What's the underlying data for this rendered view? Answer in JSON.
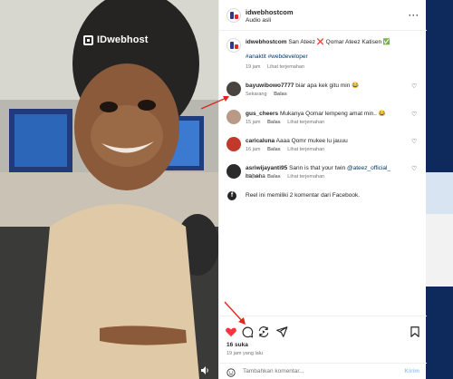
{
  "media": {
    "brand_text": "IDwebhost",
    "brand_icon": "idwebhost-logo-icon"
  },
  "header": {
    "username": "idwebhostcom",
    "subtitle": "Audio asli"
  },
  "caption": {
    "username": "idwebhostcom",
    "text": "San Ateez ❌ Qomar Ateez Katisen ✅",
    "hashtags": "#anaktit #webdeveloper",
    "time": "19 jam",
    "translate": "Lihat terjemahan"
  },
  "comments": [
    {
      "username": "bayuwibowo7777",
      "text": "biar apa kek gitu min 😂",
      "time": "Sekarang",
      "reply": "Balas",
      "translate": ""
    },
    {
      "username": "gus_cheers",
      "text": "Mukanya Qomar lempeng amat min.. 😂",
      "time": "15 jam",
      "reply": "Balas",
      "translate": "Lihat terjemahan"
    },
    {
      "username": "caricaluna",
      "text": "Aaaa Qomr mukee lu jauuu",
      "time": "16 jam",
      "reply": "Balas",
      "translate": "Lihat terjemahan"
    },
    {
      "username": "asriwijayanti95",
      "text_before": "Sann is that your twin ",
      "mention": "@ateez_official",
      "text_after": "_ hahaha",
      "time": "19 jam",
      "reply": "Balas",
      "translate": "Lihat terjemahan"
    }
  ],
  "facebook_note": "Reel ini memiliki 2 komentar dari Facebook.",
  "actions": {
    "likes": "16 suka",
    "time_ago": "19 jam yang lalu"
  },
  "add_comment": {
    "placeholder": "Tambahkan komentar...",
    "post_label": "Kirim"
  },
  "colors": {
    "like_red": "#ff3040",
    "annotation_arrow": "#e0281f",
    "link_blue": "#00376b",
    "post_disabled": "#9ec8f3"
  }
}
